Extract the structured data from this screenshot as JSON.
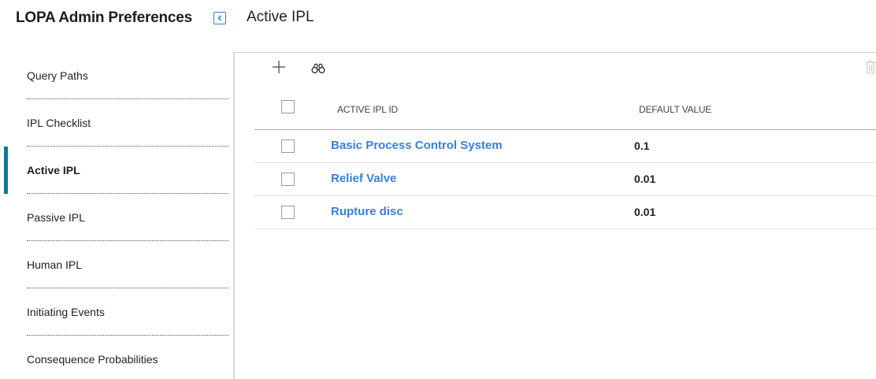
{
  "header": {
    "app_title": "LOPA Admin Preferences",
    "page_title": "Active IPL"
  },
  "sidebar": {
    "items": [
      {
        "label": "Query Paths",
        "active": false
      },
      {
        "label": "IPL Checklist",
        "active": false
      },
      {
        "label": "Active IPL",
        "active": true
      },
      {
        "label": "Passive IPL",
        "active": false
      },
      {
        "label": "Human IPL",
        "active": false
      },
      {
        "label": "Initiating Events",
        "active": false
      },
      {
        "label": "Consequence Probabilities",
        "active": false
      }
    ]
  },
  "toolbar": {
    "icons": [
      "plus-icon",
      "binoculars-icon",
      "trash-icon"
    ]
  },
  "grid": {
    "columns": [
      "ACTIVE IPL ID",
      "DEFAULT VALUE"
    ],
    "rows": [
      {
        "id": "Basic Process Control System",
        "value": "0.1"
      },
      {
        "id": "Relief Valve",
        "value": "0.01"
      },
      {
        "id": "Rupture disc",
        "value": "0.01"
      }
    ]
  },
  "colors": {
    "accent": "#0f7897",
    "link": "#3b7fd8"
  }
}
